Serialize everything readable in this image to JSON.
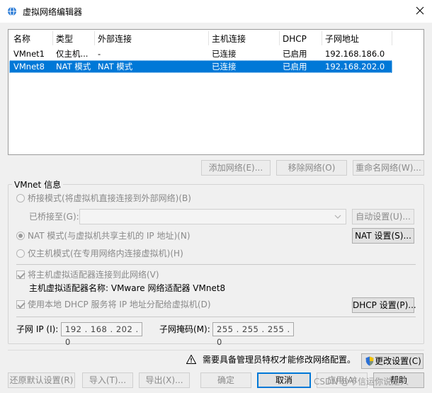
{
  "window": {
    "title": "虚拟网络编辑器"
  },
  "table": {
    "columns": [
      "名称",
      "类型",
      "外部连接",
      "主机连接",
      "DHCP",
      "子网地址"
    ],
    "rows": [
      {
        "name": "VMnet1",
        "type": "仅主机...",
        "external": "-",
        "host": "已连接",
        "dhcp": "已启用",
        "subnet": "192.168.186.0",
        "selected": false
      },
      {
        "name": "VMnet8",
        "type": "NAT 模式",
        "external": "NAT 模式",
        "host": "已连接",
        "dhcp": "已启用",
        "subnet": "192.168.202.0",
        "selected": true
      }
    ]
  },
  "list_buttons": {
    "add": "添加网络(E)...",
    "remove": "移除网络(O)",
    "rename": "重命名网络(W)..."
  },
  "vmnet_info": {
    "label": "VMnet 信息",
    "bridged": "桥接模式(将虚拟机直接连接到外部网络)(B)",
    "bridged_to": "已桥接至(G):",
    "auto": "自动设置(U)...",
    "nat": "NAT 模式(与虚拟机共享主机的 IP 地址)(N)",
    "nat_settings": "NAT 设置(S)...",
    "host_only": "仅主机模式(在专用网络内连接虚拟机)(H)",
    "connect_adapter": "将主机虚拟适配器连接到此网络(V)",
    "adapter_name": "主机虚拟适配器名称: VMware 网络适配器 VMnet8",
    "use_dhcp": "使用本地 DHCP 服务将 IP 地址分配给虚拟机(D)",
    "dhcp_settings": "DHCP 设置(P)...",
    "subnet_ip_label": "子网 IP (I):",
    "subnet_ip": "192 . 168 . 202 .  0",
    "mask_label": "子网掩码(M):",
    "mask": "255 . 255 . 255 .  0"
  },
  "admin": {
    "notice": "需要具备管理员特权才能修改网络配置。",
    "change": "更改设置(C)"
  },
  "footer": {
    "restore": "还原默认设置(R)",
    "import": "导入(T)...",
    "export": "导出(X)...",
    "ok": "确定",
    "cancel": "取消",
    "apply": "应用(A)",
    "help": "帮助"
  },
  "watermark": "CSDN @不信运你说是人"
}
